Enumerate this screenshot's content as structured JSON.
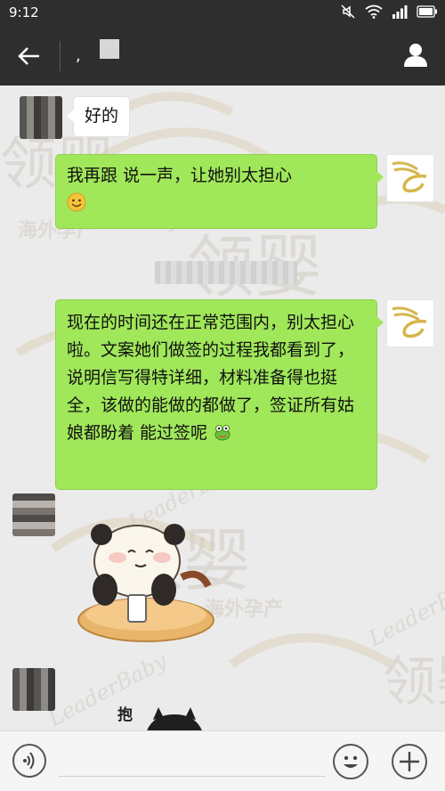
{
  "status_bar": {
    "time": "9:12",
    "icons": [
      "mute-icon",
      "wifi-icon",
      "signal-icon",
      "battery-icon"
    ]
  },
  "nav": {
    "title": ",",
    "back_icon": "back-arrow-icon",
    "profile_icon": "profile-icon"
  },
  "messages": [
    {
      "side": "left",
      "text": "好的"
    },
    {
      "side": "right",
      "text": "我再跟    说一声，让她别太担心",
      "emoji": "smile-emoji"
    },
    {
      "side": "right",
      "text": "现在的时间还在正常范围内，别太担心啦。文案她们做签的过程我都看到了，说明信写得特详细，材料准备得也挺全，该做的能做的都做了，签证所有姑娘都盼着    能过签呢",
      "emoji": "frog-emoji"
    },
    {
      "side": "left",
      "type": "sticker",
      "sticker": "panda-phone-sticker"
    },
    {
      "side": "left",
      "type": "sticker",
      "text": "抱",
      "sticker": "cat-sticker"
    }
  ],
  "watermark": {
    "brand_cn": "领婴",
    "brand_en": "LeaderBaby",
    "tagline": "海外孕产"
  },
  "input_bar": {
    "voice_icon": "voice-icon",
    "emoji_icon": "emoji-icon",
    "add_icon": "plus-icon"
  },
  "colors": {
    "header": "#2e2e2e",
    "chat_bg": "#ebebeb",
    "bubble_right": "#a0e75a",
    "bubble_left": "#ffffff"
  }
}
